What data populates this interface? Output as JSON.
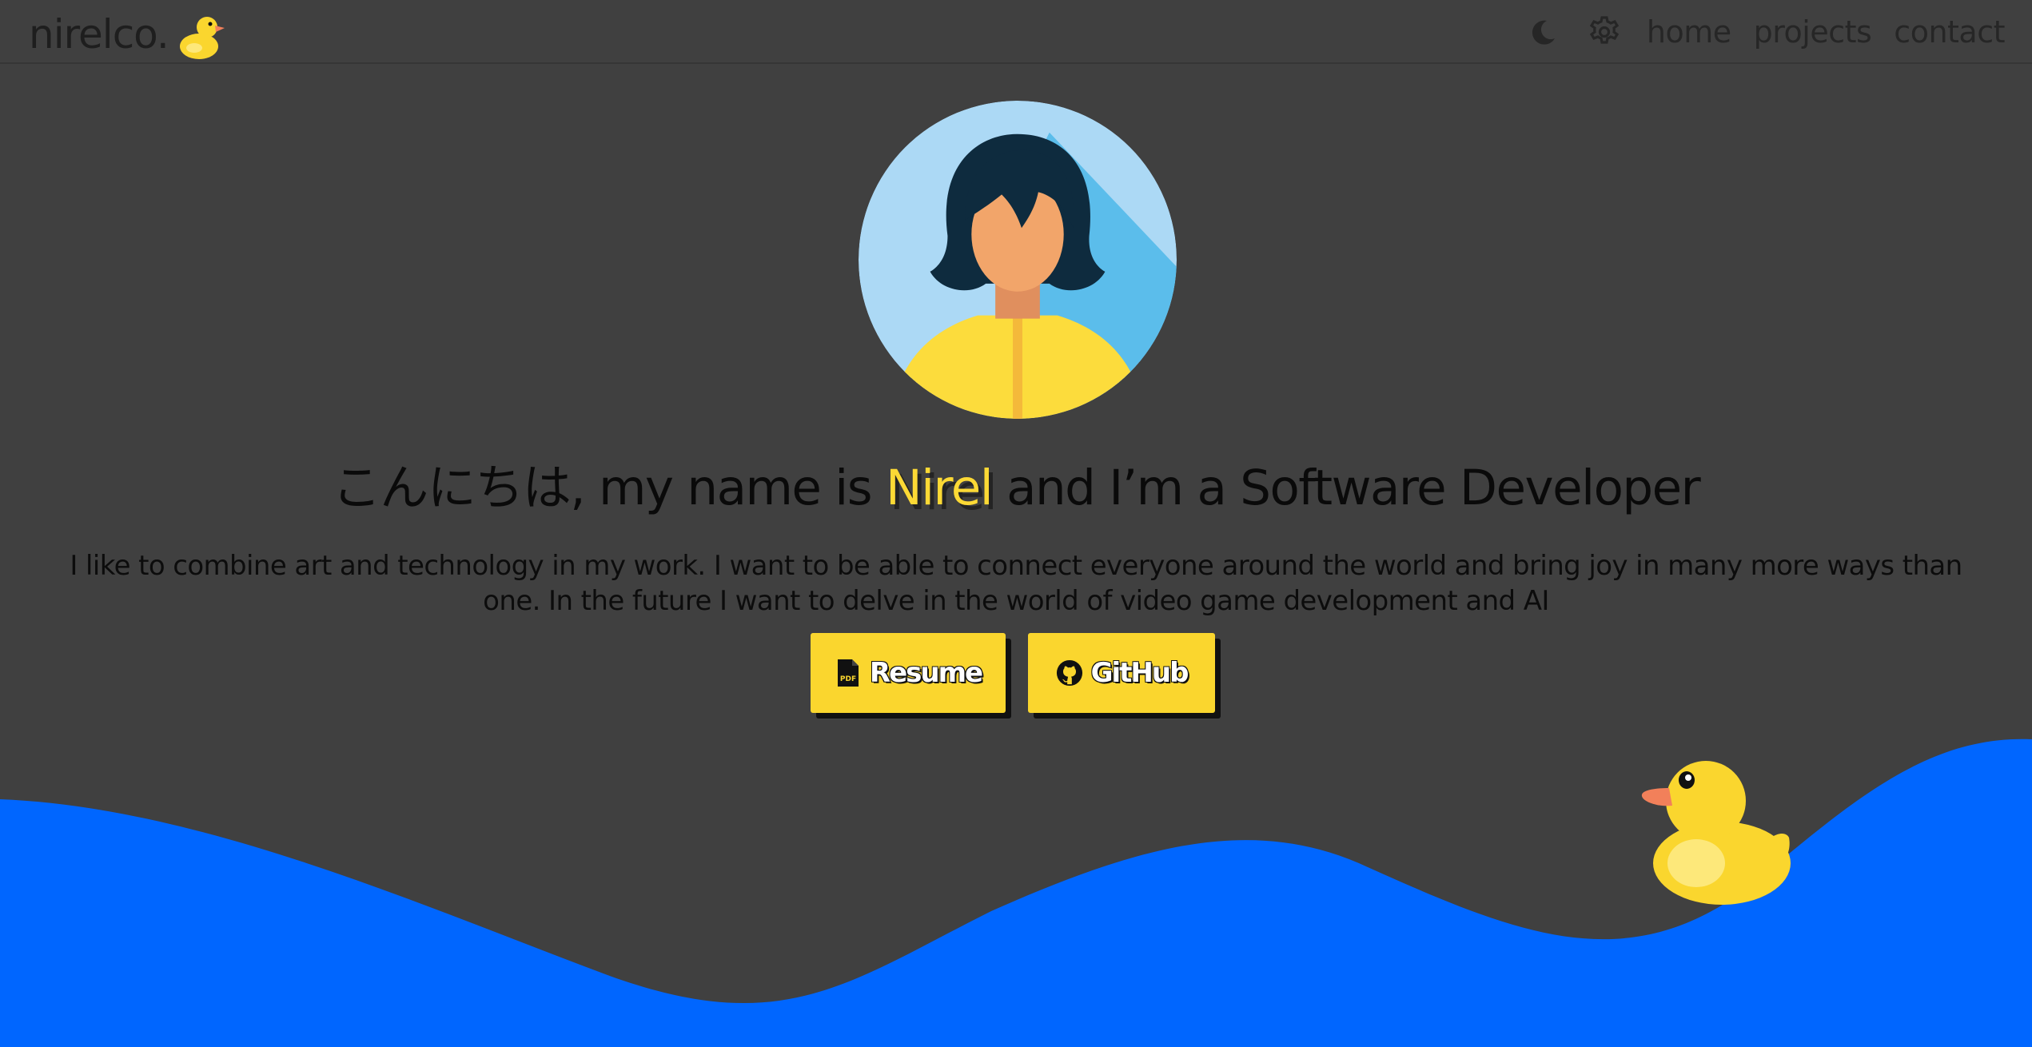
{
  "header": {
    "brand": "nirelco.",
    "brand_icon": "rubber-duck-icon",
    "theme_toggle_icon": "moon-icon",
    "settings_icon": "gear-icon",
    "nav": {
      "home": "home",
      "projects": "projects",
      "contact": "contact"
    }
  },
  "hero": {
    "avatar_icon": "woman-avatar-illustration",
    "headline_before": "こんにちは, my name is ",
    "headline_name": "Nirel",
    "headline_after": " and I’m a Software Developer",
    "intro": "I like to combine art and technology in my work. I want to be able to connect everyone around the world and bring joy in many more ways than one. In the future I want to delve in the world of video game development and AI",
    "buttons": {
      "resume_label": "Resume",
      "resume_icon": "pdf-file-icon",
      "github_label": "GitHub",
      "github_icon": "github-icon"
    }
  },
  "decor": {
    "floating_duck_icon": "rubber-duck-icon",
    "wave_color": "#0066ff"
  },
  "colors": {
    "background": "#404040",
    "accent": "#fcd935",
    "wave": "#0066ff"
  }
}
